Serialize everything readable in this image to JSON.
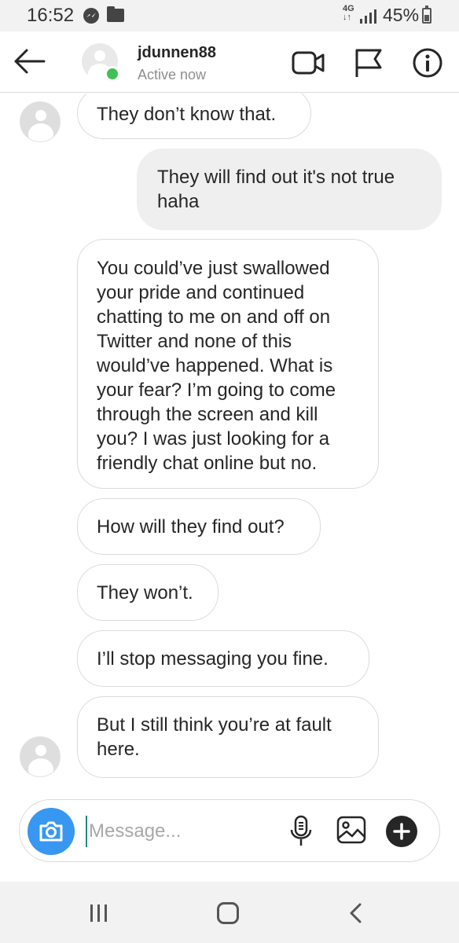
{
  "status_bar": {
    "time": "16:52",
    "network_type": "4G",
    "battery_percent": "45%",
    "icons": [
      "messenger-icon",
      "folder-icon",
      "signal-icon",
      "battery-icon"
    ]
  },
  "header": {
    "username": "jdunnen88",
    "status": "Active now",
    "icons": [
      "back-arrow-icon",
      "avatar",
      "video-call-icon",
      "flag-icon",
      "info-icon"
    ]
  },
  "messages": [
    {
      "direction": "received",
      "text": "They don’t know that.",
      "avatar_shown": true
    },
    {
      "direction": "sent",
      "text": "They will find out it's not true haha",
      "avatar_shown": false
    },
    {
      "direction": "received",
      "text": "You could’ve just swallowed your pride and continued chatting to me on and off on Twitter and none of this would’ve happened. What is your fear? I’m going to come through the screen and kill you? I was just looking for a friendly chat online but no.",
      "avatar_shown": false
    },
    {
      "direction": "received",
      "text": "How will they find out?",
      "avatar_shown": false
    },
    {
      "direction": "received",
      "text": "They won’t.",
      "avatar_shown": false
    },
    {
      "direction": "received",
      "text": "I’ll stop messaging you fine.",
      "avatar_shown": false
    },
    {
      "direction": "received",
      "text": "But I still think you’re at fault here.",
      "avatar_shown": true
    }
  ],
  "composer": {
    "placeholder": "Message...",
    "value": "",
    "icons": [
      "camera-icon",
      "microphone-icon",
      "gallery-icon",
      "plus-icon"
    ]
  },
  "colors": {
    "accent": "#3897f0",
    "active_indicator": "#40c057",
    "sent_bubble": "#efefef",
    "received_border": "#dbdbdb"
  },
  "nav_bar": {
    "icons": [
      "recent-apps-icon",
      "home-icon",
      "back-icon"
    ]
  }
}
